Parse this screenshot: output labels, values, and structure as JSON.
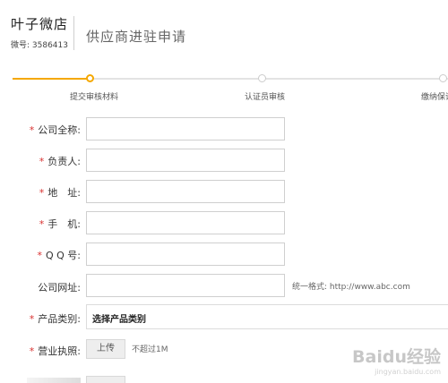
{
  "header": {
    "shop_name": "叶子微店",
    "shop_id": "微号: 3586413",
    "page_title": "供应商进驻申请"
  },
  "steps": [
    {
      "label": "提交审核材料",
      "state": "active"
    },
    {
      "label": "认证员审核",
      "state": "pending"
    },
    {
      "label": "缴纳保证",
      "state": "pending"
    }
  ],
  "form": {
    "fields": [
      {
        "label": "公司全称:",
        "required": true,
        "value": ""
      },
      {
        "label": "负责人:",
        "required": true,
        "value": ""
      },
      {
        "label": "地　址:",
        "required": true,
        "value": ""
      },
      {
        "label": "手　机:",
        "required": true,
        "value": ""
      },
      {
        "label": "Q Q 号:",
        "required": true,
        "value": ""
      },
      {
        "label": "公司网址:",
        "required": false,
        "value": ""
      }
    ],
    "website_hint": "统一格式: http://www.abc.com",
    "category": {
      "label": "产品类别:",
      "selected": "选择产品类别"
    },
    "license": {
      "label": "营业执照:",
      "button": "上传",
      "hint": "不超过1M"
    }
  },
  "watermark": {
    "logo": "Baidu经验",
    "url": "jingyan.baidu.com"
  },
  "colors": {
    "accent": "#f5a800",
    "required": "#d9302f",
    "border": "#cfcfcf"
  }
}
